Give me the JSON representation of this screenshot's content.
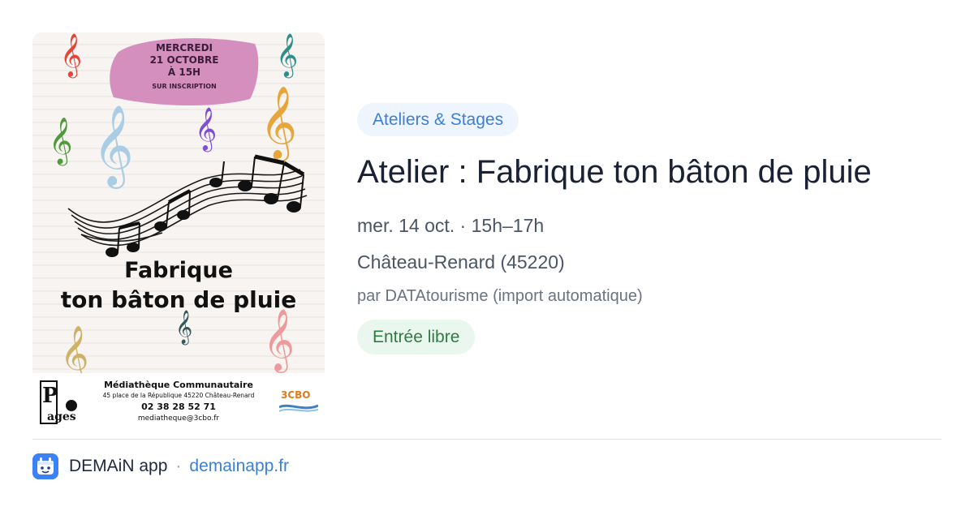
{
  "poster": {
    "date_lines": [
      "MERCREDI",
      "21 OCTOBRE",
      "À 15H"
    ],
    "inscription": "SUR INSCRIPTION",
    "title_line1": "Fabrique",
    "title_line2": "ton bâton de pluie",
    "org_name": "Médiathèque Communautaire",
    "org_address": "45 place de la République 45220 Château-Renard",
    "org_phone": "02 38 28 52 71",
    "org_email": "mediatheque@3cbo.fr",
    "left_logo_text": "Pas à Pages",
    "right_logo_text": "3CBO"
  },
  "event": {
    "category": "Ateliers & Stages",
    "title": "Atelier : Fabrique ton bâton de pluie",
    "when": "mer. 14 oct. · 15h–17h",
    "where": "Château-Renard (45220)",
    "source": "par DATAtourisme (import automatique)",
    "price": "Entrée libre"
  },
  "footer": {
    "app_name": "DEMAiN app",
    "separator": "·",
    "site": "demainapp.fr"
  },
  "colors": {
    "accent": "#3d7fd6",
    "category_bg": "#eff5fe",
    "price_fg": "#2f7b45",
    "price_bg": "#eaf7ee",
    "date_blob": "#d48fbe"
  }
}
